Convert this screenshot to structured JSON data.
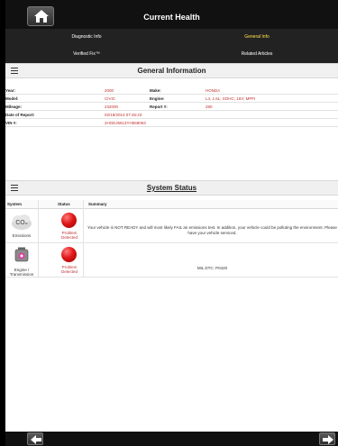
{
  "window": {
    "title": "Current Health"
  },
  "tabs": [
    {
      "label": "Diagnostic Info",
      "active": false
    },
    {
      "label": "General Info",
      "active": true
    },
    {
      "label": "Verified Fix™",
      "active": false
    },
    {
      "label": "Related Articles",
      "active": false
    }
  ],
  "general": {
    "title": "General Information",
    "fields": {
      "year_label": "Year:",
      "year": "2000",
      "make_label": "Make:",
      "make": "HONDA",
      "model_label": "Model:",
      "model": "CIVIC",
      "engine_label": "Engine:",
      "engine": "L4, 1.6L; SOHC; 16V; MPFI",
      "mileage_label": "Mileage:",
      "mileage": "232000",
      "report_label": "Report #:",
      "report": "280",
      "date_label": "Date of Report:",
      "date": "02/18/2014 07:45:23",
      "vin_label": "VIN #:",
      "vin": "2HGEJ6613YH568063"
    }
  },
  "system_status": {
    "title": "System Status",
    "columns": {
      "system": "System",
      "status": "Status",
      "summary": "Summary"
    },
    "rows": [
      {
        "system": "Emissions",
        "icon": "co2-icon",
        "status": "Problem Detected",
        "summary": "Your vehicle is NOT READY and will most likely FAIL an emissions test. In addition, your vehicle could be polluting the environment. Please have your vehicle serviced."
      },
      {
        "system": "Engine / Transmission",
        "icon": "engine-icon",
        "status": "Problem Detected",
        "summary": "MIL DTC: P0420"
      }
    ]
  },
  "colors": {
    "accent_tab": "#ffe14a",
    "value_red": "#c03030",
    "bar": "#111111"
  }
}
